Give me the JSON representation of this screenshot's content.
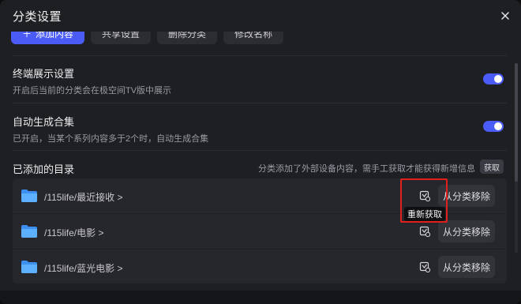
{
  "dialog": {
    "title": "分类设置"
  },
  "top_actions": [
    {
      "label": "添加内容"
    },
    {
      "label": "共享设置"
    },
    {
      "label": "删除分类"
    },
    {
      "label": "修改名称"
    }
  ],
  "settings": [
    {
      "title": "终端展示设置",
      "desc": "开启后当前的分类会在极空间TV版中展示",
      "enabled": true
    },
    {
      "title": "自动生成合集",
      "desc": "已开启，当某个系列内容多于2个时，自动生成合集",
      "enabled": true
    }
  ],
  "directories": {
    "title": "已添加的目录",
    "hint": "分类添加了外部设备内容，需手工获取才能获得新增信息",
    "fetch_label": "获取",
    "items": [
      {
        "path": "/115life/最近接收 >",
        "remove_label": "从分类移除"
      },
      {
        "path": "/115life/电影 >",
        "remove_label": "从分类移除"
      },
      {
        "path": "/115life/蓝光电影 >",
        "remove_label": "从分类移除"
      }
    ],
    "tooltip": "重新获取"
  },
  "colors": {
    "accent": "#4a5cf5",
    "highlight": "#e0211b",
    "folder": "#4aa3ff"
  }
}
